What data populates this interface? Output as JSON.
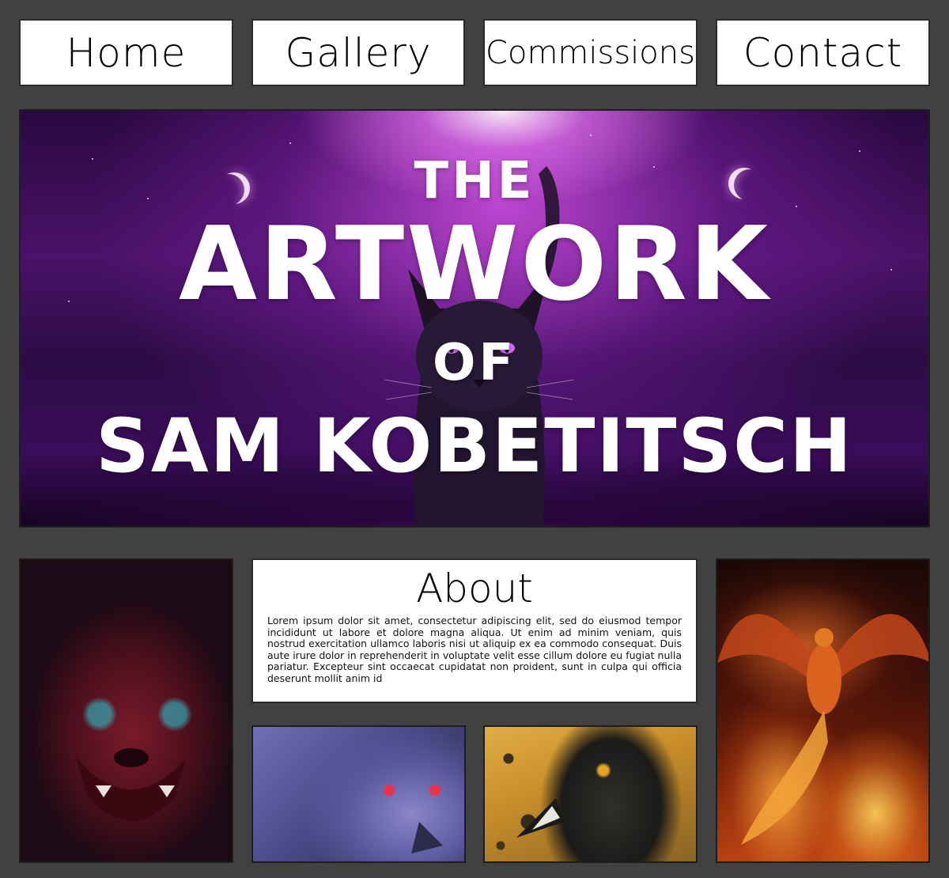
{
  "nav": {
    "home_label": "Home",
    "gallery_label": "Gallery",
    "commissions_label": "Commissions",
    "contact_label": "Contact"
  },
  "hero": {
    "line1": "THE",
    "line2": "ARTWORK",
    "line3": "OF",
    "line4": "SAM KOBETITSCH"
  },
  "about": {
    "title": "About",
    "body": "Lorem ipsum dolor sit amet, consectetur adipiscing elit, sed do eiusmod tempor incididunt ut labore et dolore magna aliqua. Ut enim ad minim veniam, quis nostrud exercitation ullamco laboris nisi ut aliquip ex ea commodo consequat. Duis aute irure dolor in reprehenderit in voluptate velit esse cillum dolore eu fugiat nulla pariatur. Excepteur sint occaecat cupidatat non proident, sunt in culpa qui officia deserunt mollit anim id"
  },
  "colors": {
    "page_background": "#414141",
    "panel_background": "#ffffff",
    "hero_accent": "#c040e0"
  },
  "icons": {
    "hero_art": "black-cat-artwork",
    "gallery_1": "red-lion-artwork",
    "gallery_2": "blue-wolf-artwork",
    "gallery_3": "raven-artwork",
    "gallery_4": "phoenix-artwork"
  }
}
